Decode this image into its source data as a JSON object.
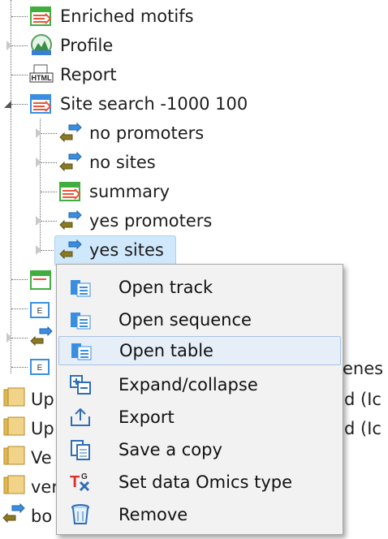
{
  "tree": {
    "items": [
      {
        "label": "Enriched motifs",
        "icon": "table-icon"
      },
      {
        "label": "Profile",
        "icon": "profile-icon"
      },
      {
        "label": "Report",
        "icon": "html-icon"
      },
      {
        "label": "Site search -1000 100",
        "icon": "table-icon"
      },
      {
        "label": "no promoters",
        "icon": "track-icon"
      },
      {
        "label": "no sites",
        "icon": "track-icon"
      },
      {
        "label": "summary",
        "icon": "table-icon"
      },
      {
        "label": "yes promoters",
        "icon": "track-icon"
      },
      {
        "label": "yes sites",
        "icon": "track-icon"
      }
    ],
    "partial": {
      "right_1": "enes",
      "row_up1_left": "Up",
      "row_up1_right": "d (Ic",
      "row_up2_left": "Up",
      "row_up2_right": "d (Ic",
      "row_ve_left": "Ve",
      "row_ver_left": "ver",
      "row_bo_left": "bo"
    }
  },
  "context_menu": {
    "items": [
      {
        "label": "Open track",
        "icon": "open-track-icon"
      },
      {
        "label": "Open sequence",
        "icon": "open-sequence-icon"
      },
      {
        "label": "Open table",
        "icon": "open-table-icon"
      },
      {
        "label": "Expand/collapse",
        "icon": "expand-collapse-icon"
      },
      {
        "label": "Export",
        "icon": "export-icon"
      },
      {
        "label": "Save a copy",
        "icon": "save-copy-icon"
      },
      {
        "label": "Set data Omics type",
        "icon": "omics-type-icon"
      },
      {
        "label": "Remove",
        "icon": "trash-icon"
      }
    ],
    "hovered_index": 2
  },
  "colors": {
    "selection_bg": "#cfe8fb",
    "menu_bg": "#f2f2f2",
    "hover_bg": "#e6eef8",
    "table_green": "#3fae3f",
    "track_blue": "#3a8ee0",
    "track_olive": "#8a7a22",
    "folder_tan": "#f1d48a"
  }
}
